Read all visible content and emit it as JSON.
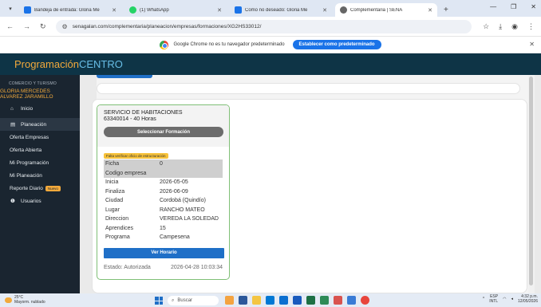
{
  "browser": {
    "tabs": [
      {
        "title": "Bandeja de entrada: Gloria Me",
        "fav_color": "#1a73e8"
      },
      {
        "title": "(1) WhatsApp",
        "fav_color": "#25d366"
      },
      {
        "title": "Como no deseado: Gloria Me",
        "fav_color": "#1a73e8"
      },
      {
        "title": "Complementaria | SENA",
        "fav_color": "#666666",
        "active": true
      }
    ],
    "url": "senagalan.com/complementaria/planeacion/empresas/formaciones/XG2HS33012/",
    "infobar_text": "Google Chrome no es tu navegador predeterminado",
    "infobar_button": "Establecer como predeterminado"
  },
  "app": {
    "brand_part1": "Programación",
    "brand_part2": "CENTRO"
  },
  "sidebar": {
    "org": "COMERCIO Y TURISMO",
    "user_line1": "GLORIA MERCEDES",
    "user_line2": "ALVAREZ JARAMILLO",
    "items": [
      {
        "label": "Inicio",
        "icon": "home-icon",
        "glyph": "⌂"
      },
      {
        "label": "Planeación",
        "icon": "document-icon",
        "glyph": "▤",
        "active": true
      },
      {
        "label": "Oferta Empresas"
      },
      {
        "label": "Oferta Abierta"
      },
      {
        "label": "Mi Programación"
      },
      {
        "label": "Mi Planeación"
      },
      {
        "label": "Reporte Diario",
        "badge": "Nuevo"
      },
      {
        "label": "Usuarios",
        "icon": "info-icon",
        "glyph": "❶"
      }
    ]
  },
  "card": {
    "title": "SERVICIO DE HABITACIONES",
    "subtitle": "63340014 - 40 Horas",
    "select_button": "Seleccionar Formación",
    "warning_badge": "Falta verificar oficio de estructuración",
    "rows": [
      {
        "key": "Ficha",
        "value": "0",
        "grey": true
      },
      {
        "key": "Codigo empresa",
        "value": "",
        "grey": true
      },
      {
        "key": "Inicia",
        "value": "2026-05-05"
      },
      {
        "key": "Finaliza",
        "value": "2026-06-09"
      },
      {
        "key": "Ciudad",
        "value": "Cordobá (Quindío)"
      },
      {
        "key": "Lugar",
        "value": "RANCHO MATEO"
      },
      {
        "key": "Direccion",
        "value": "VEREDA LA SOLEDAD"
      },
      {
        "key": "Aprendices",
        "value": "15"
      },
      {
        "key": "Programa",
        "value": "Campesena"
      }
    ],
    "horario_button": "Ver Horario",
    "status": "Estado: Autorizada",
    "timestamp": "2026-04-28 10:03:34"
  },
  "taskbar": {
    "temp": "25°C",
    "weather": "Mayorm. nublado",
    "search_placeholder": "Buscar",
    "lang1": "ESP",
    "lang2": "INTL",
    "time": "4:32 p.m.",
    "date": "12/05/2026"
  }
}
